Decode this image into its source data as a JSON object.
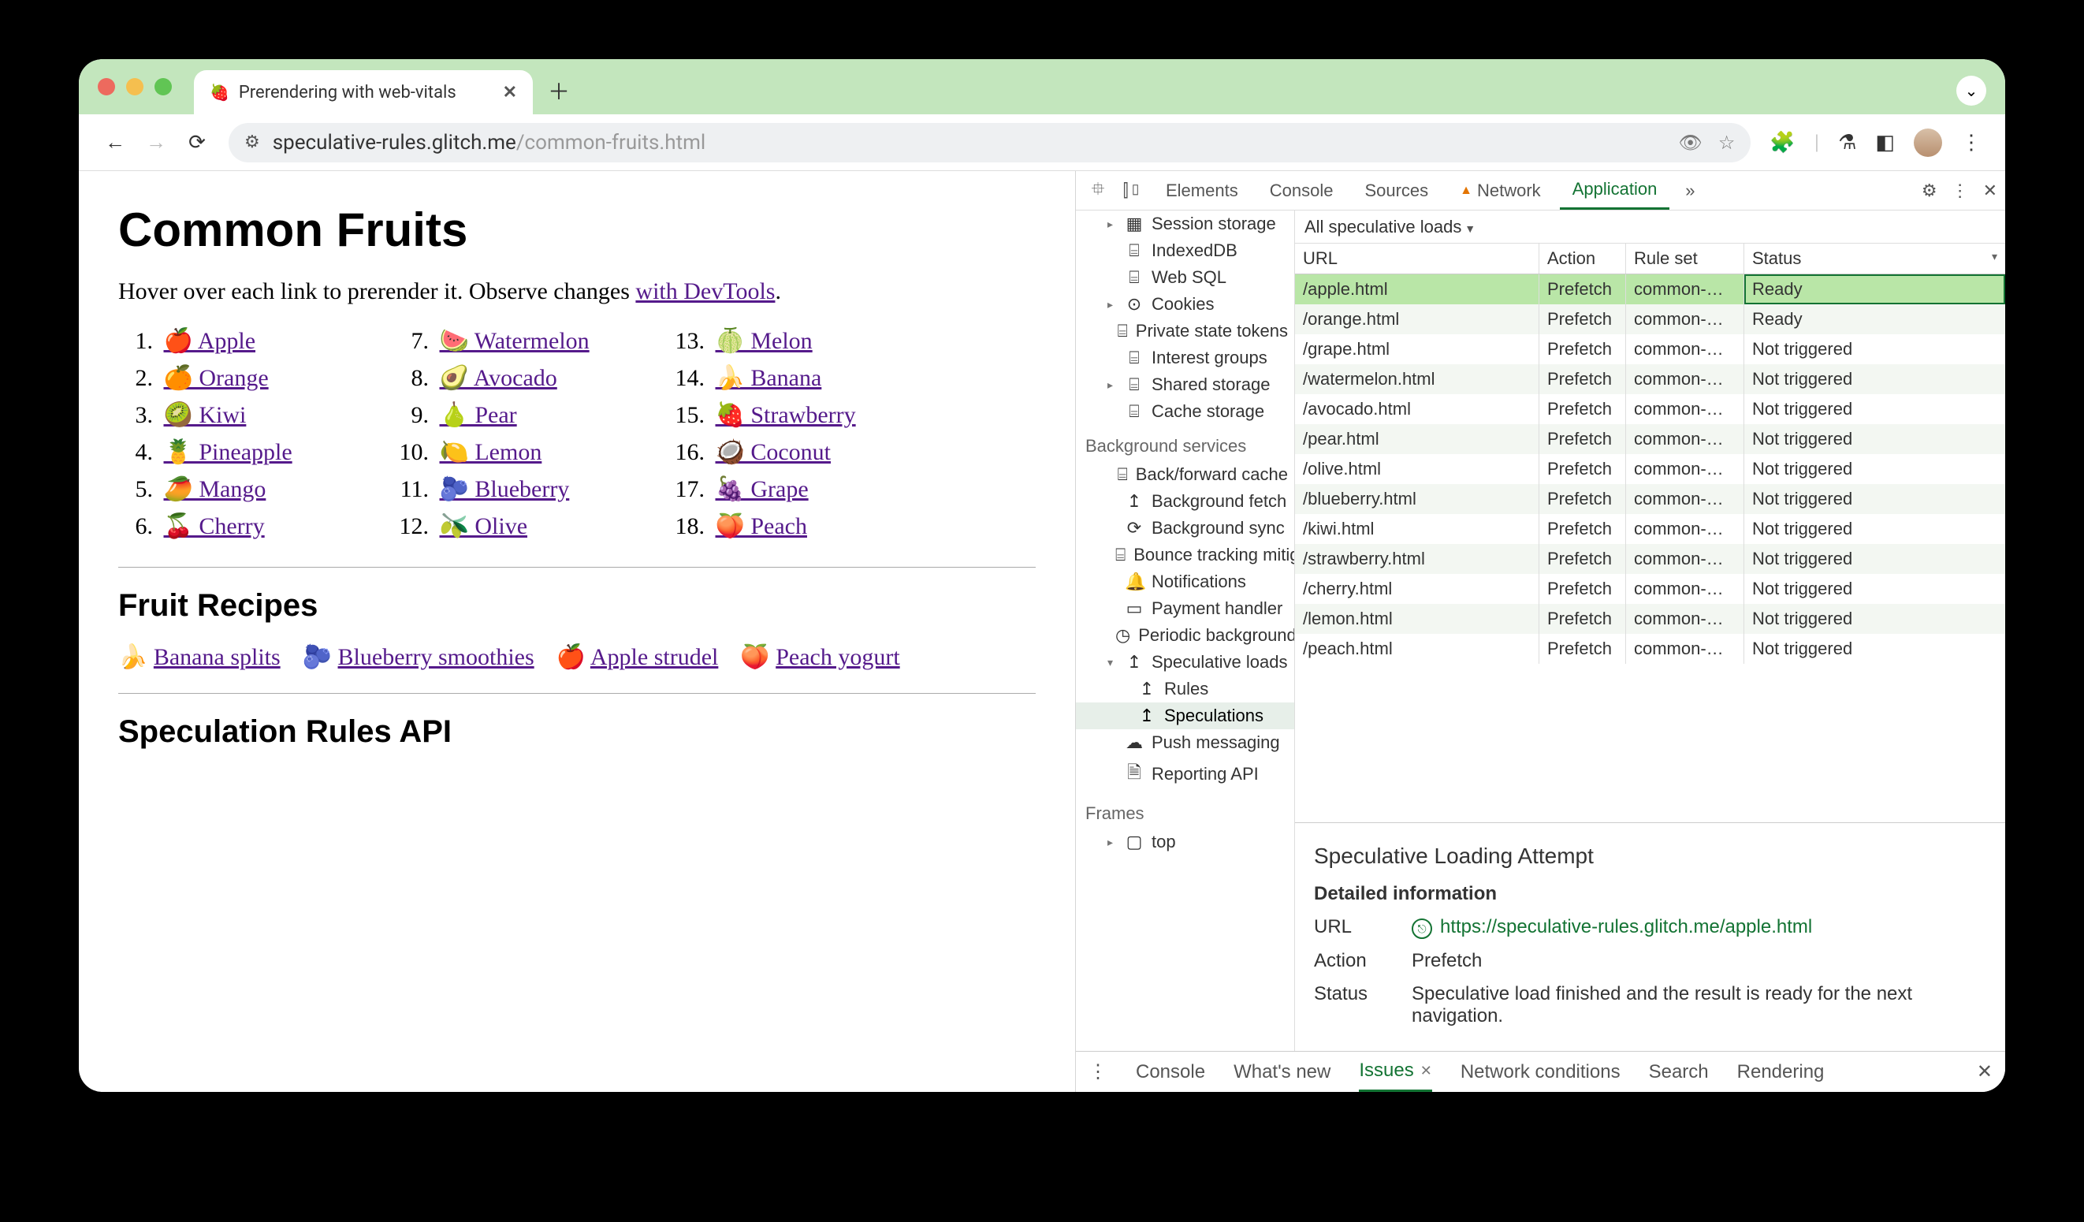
{
  "tab": {
    "title": "Prerendering with web-vitals"
  },
  "omnibox": {
    "domain": "speculative-rules.glitch.me",
    "path": "/common-fruits.html"
  },
  "page": {
    "h1": "Common Fruits",
    "intro_a": "Hover over each link to prerender it. Observe changes ",
    "intro_link": "with DevTools",
    "intro_b": ".",
    "fruits": [
      {
        "n": "1.",
        "e": "🍎",
        "t": "Apple"
      },
      {
        "n": "2.",
        "e": "🍊",
        "t": "Orange"
      },
      {
        "n": "3.",
        "e": "🥝",
        "t": "Kiwi"
      },
      {
        "n": "4.",
        "e": "🍍",
        "t": "Pineapple"
      },
      {
        "n": "5.",
        "e": "🥭",
        "t": "Mango"
      },
      {
        "n": "6.",
        "e": "🍒",
        "t": "Cherry"
      },
      {
        "n": "7.",
        "e": "🍉",
        "t": "Watermelon"
      },
      {
        "n": "8.",
        "e": "🥑",
        "t": "Avocado"
      },
      {
        "n": "9.",
        "e": "🍐",
        "t": "Pear"
      },
      {
        "n": "10.",
        "e": "🍋",
        "t": "Lemon"
      },
      {
        "n": "11.",
        "e": "🫐",
        "t": "Blueberry"
      },
      {
        "n": "12.",
        "e": "🫒",
        "t": "Olive"
      },
      {
        "n": "13.",
        "e": "🍈",
        "t": "Melon"
      },
      {
        "n": "14.",
        "e": "🍌",
        "t": "Banana"
      },
      {
        "n": "15.",
        "e": "🍓",
        "t": "Strawberry"
      },
      {
        "n": "16.",
        "e": "🥥",
        "t": "Coconut"
      },
      {
        "n": "17.",
        "e": "🍇",
        "t": "Grape"
      },
      {
        "n": "18.",
        "e": "🍑",
        "t": "Peach"
      }
    ],
    "h2a": "Fruit Recipes",
    "recipes": [
      {
        "e": "🍌",
        "t": "Banana splits"
      },
      {
        "e": "🫐",
        "t": "Blueberry smoothies"
      },
      {
        "e": "🍎",
        "t": "Apple strudel"
      },
      {
        "e": "🍑",
        "t": "Peach yogurt"
      }
    ],
    "h2b": "Speculation Rules API"
  },
  "devtools": {
    "tabs": [
      "Elements",
      "Console",
      "Sources",
      "Network",
      "Application"
    ],
    "activeTab": "Application",
    "sidebar_storage": [
      {
        "arrow": "▸",
        "ic": "▦",
        "t": "Session storage",
        "lvl": 1
      },
      {
        "arrow": "",
        "ic": "⌸",
        "t": "IndexedDB",
        "lvl": 1
      },
      {
        "arrow": "",
        "ic": "⌸",
        "t": "Web SQL",
        "lvl": 1
      },
      {
        "arrow": "▸",
        "ic": "⊙",
        "t": "Cookies",
        "lvl": 1
      },
      {
        "arrow": "",
        "ic": "⌸",
        "t": "Private state tokens",
        "lvl": 1
      },
      {
        "arrow": "",
        "ic": "⌸",
        "t": "Interest groups",
        "lvl": 1
      },
      {
        "arrow": "▸",
        "ic": "⌸",
        "t": "Shared storage",
        "lvl": 1
      },
      {
        "arrow": "",
        "ic": "⌸",
        "t": "Cache storage",
        "lvl": 1
      }
    ],
    "bg_header": "Background services",
    "sidebar_bg": [
      {
        "ic": "⌸",
        "t": "Back/forward cache",
        "lvl": 1
      },
      {
        "ic": "↥",
        "t": "Background fetch",
        "lvl": 1
      },
      {
        "ic": "⟳",
        "t": "Background sync",
        "lvl": 1
      },
      {
        "ic": "⌸",
        "t": "Bounce tracking mitigations",
        "lvl": 1
      },
      {
        "ic": "🔔",
        "t": "Notifications",
        "lvl": 1
      },
      {
        "ic": "▭",
        "t": "Payment handler",
        "lvl": 1
      },
      {
        "ic": "◷",
        "t": "Periodic background sync",
        "lvl": 1
      },
      {
        "arrow": "▾",
        "ic": "↥",
        "t": "Speculative loads",
        "lvl": 1
      },
      {
        "ic": "↥",
        "t": "Rules",
        "lvl": 2
      },
      {
        "ic": "↥",
        "t": "Speculations",
        "lvl": 2,
        "sel": true
      },
      {
        "ic": "☁",
        "t": "Push messaging",
        "lvl": 1
      },
      {
        "ic": "🗎",
        "t": "Reporting API",
        "lvl": 1
      }
    ],
    "frames_header": "Frames",
    "frames": [
      {
        "arrow": "▸",
        "ic": "▢",
        "t": "top",
        "lvl": 1
      }
    ],
    "filter": "All speculative loads",
    "cols": {
      "url": "URL",
      "action": "Action",
      "rule": "Rule set",
      "status": "Status"
    },
    "rows": [
      {
        "url": "/apple.html",
        "action": "Prefetch",
        "rule": "common-…",
        "status": "Ready",
        "sel": true
      },
      {
        "url": "/orange.html",
        "action": "Prefetch",
        "rule": "common-…",
        "status": "Ready"
      },
      {
        "url": "/grape.html",
        "action": "Prefetch",
        "rule": "common-…",
        "status": "Not triggered"
      },
      {
        "url": "/watermelon.html",
        "action": "Prefetch",
        "rule": "common-…",
        "status": "Not triggered"
      },
      {
        "url": "/avocado.html",
        "action": "Prefetch",
        "rule": "common-…",
        "status": "Not triggered"
      },
      {
        "url": "/pear.html",
        "action": "Prefetch",
        "rule": "common-…",
        "status": "Not triggered"
      },
      {
        "url": "/olive.html",
        "action": "Prefetch",
        "rule": "common-…",
        "status": "Not triggered"
      },
      {
        "url": "/blueberry.html",
        "action": "Prefetch",
        "rule": "common-…",
        "status": "Not triggered"
      },
      {
        "url": "/kiwi.html",
        "action": "Prefetch",
        "rule": "common-…",
        "status": "Not triggered"
      },
      {
        "url": "/strawberry.html",
        "action": "Prefetch",
        "rule": "common-…",
        "status": "Not triggered"
      },
      {
        "url": "/cherry.html",
        "action": "Prefetch",
        "rule": "common-…",
        "status": "Not triggered"
      },
      {
        "url": "/lemon.html",
        "action": "Prefetch",
        "rule": "common-…",
        "status": "Not triggered"
      },
      {
        "url": "/peach.html",
        "action": "Prefetch",
        "rule": "common-…",
        "status": "Not triggered"
      }
    ],
    "detail": {
      "title": "Speculative Loading Attempt",
      "subtitle": "Detailed information",
      "url_k": "URL",
      "url_v": "https://speculative-rules.glitch.me/apple.html",
      "action_k": "Action",
      "action_v": "Prefetch",
      "status_k": "Status",
      "status_v": "Speculative load finished and the result is ready for the next navigation."
    },
    "drawer": [
      "Console",
      "What's new",
      "Issues",
      "Network conditions",
      "Search",
      "Rendering"
    ],
    "drawer_active": "Issues"
  }
}
